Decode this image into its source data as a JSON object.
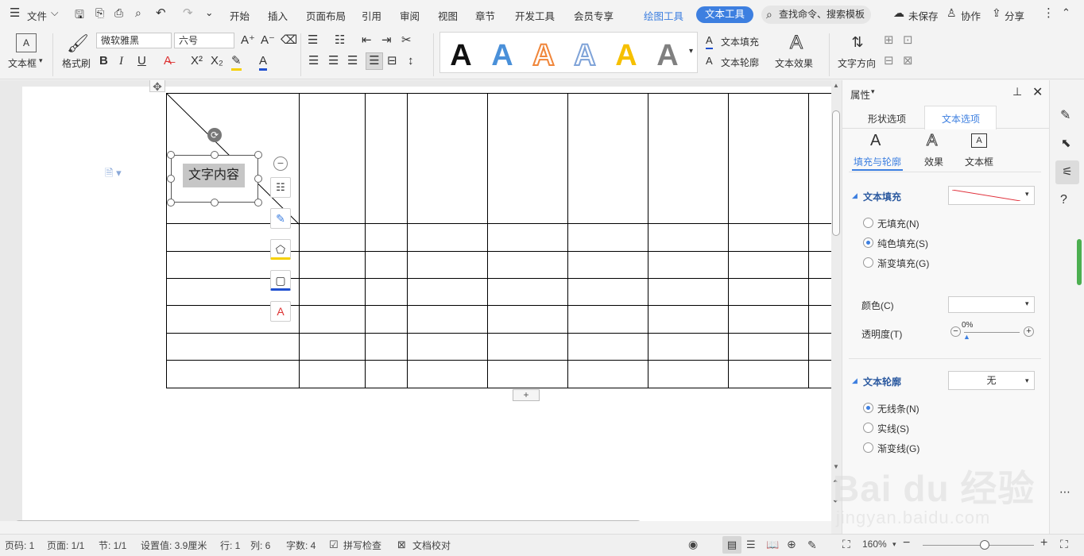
{
  "menubar": {
    "file": "文件",
    "tabs": [
      "开始",
      "插入",
      "页面布局",
      "引用",
      "审阅",
      "视图",
      "章节",
      "开发工具",
      "会员专享"
    ],
    "draw_tools": "绘图工具",
    "text_tools": "文本工具",
    "search": "查找命令、搜索模板",
    "unsaved": "未保存",
    "collab": "协作",
    "share": "分享"
  },
  "ribbon": {
    "textbox": "文本框",
    "format_painter": "格式刷",
    "font_name": "微软雅黑",
    "font_size": "六号",
    "text_fill": "文本填充",
    "text_outline": "文本轮廓",
    "text_effect": "文本效果",
    "text_direction": "文字方向",
    "art_colors": [
      "#111111",
      "#4a90d9",
      "#f0863a",
      "#7fa3d8",
      "#f6c000",
      "#808080"
    ]
  },
  "document": {
    "textbox_content": "文字内容"
  },
  "panel": {
    "title": "属性",
    "tab_shape": "形状选项",
    "tab_text": "文本选项",
    "sub_fill": "填充与轮廓",
    "sub_effect": "效果",
    "sub_textbox": "文本框",
    "fill_header": "文本填充",
    "fill_none": "无填充(N)",
    "fill_solid": "纯色填充(S)",
    "fill_gradient": "渐变填充(G)",
    "color_label": "颜色(C)",
    "transparency_label": "透明度(T)",
    "transparency_value": "0%",
    "outline_header": "文本轮廓",
    "outline_value": "无",
    "outline_none": "无线条(N)",
    "outline_solid": "实线(S)",
    "outline_gradient": "渐变线(G)"
  },
  "status": {
    "page_code": "页码: 1",
    "page": "页面: 1/1",
    "section": "节: 1/1",
    "setting": "设置值: 3.9厘米",
    "row": "行: 1",
    "col": "列: 6",
    "words": "字数: 4",
    "spell": "拼写检查",
    "proof": "文档校对",
    "zoom": "160%"
  },
  "watermark": {
    "brand": "Bai du 经验",
    "url": "jingyan.baidu.com"
  }
}
